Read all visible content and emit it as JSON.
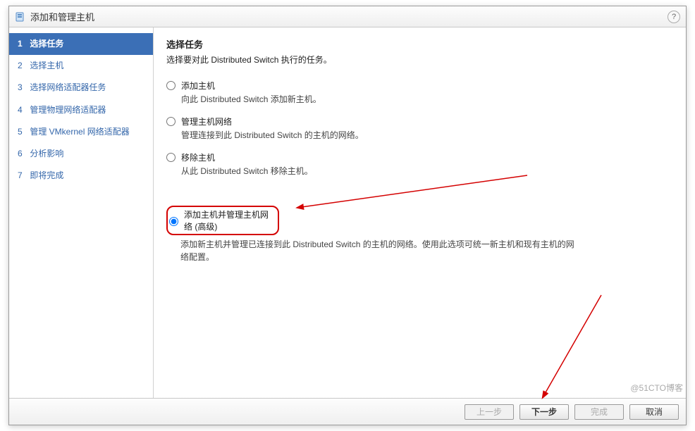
{
  "title": "添加和管理主机",
  "help_tooltip": "?",
  "steps": [
    {
      "num": "1",
      "label": "选择任务",
      "current": true
    },
    {
      "num": "2",
      "label": "选择主机",
      "current": false
    },
    {
      "num": "3",
      "label": "选择网络适配器任务",
      "current": false
    },
    {
      "num": "4",
      "label": "管理物理网络适配器",
      "current": false
    },
    {
      "num": "5",
      "label": "管理 VMkernel 网络适配器",
      "current": false
    },
    {
      "num": "6",
      "label": "分析影响",
      "current": false
    },
    {
      "num": "7",
      "label": "即将完成",
      "current": false
    }
  ],
  "main": {
    "heading": "选择任务",
    "subtitle": "选择要对此 Distributed Switch 执行的任务。",
    "options": [
      {
        "label": "添加主机",
        "desc": "向此 Distributed Switch 添加新主机。",
        "selected": false
      },
      {
        "label": "管理主机网络",
        "desc": "管理连接到此 Distributed Switch 的主机的网络。",
        "selected": false
      },
      {
        "label": "移除主机",
        "desc": "从此 Distributed Switch 移除主机。",
        "selected": false
      },
      {
        "label": "添加主机并管理主机网络 (高级)",
        "desc": "添加新主机并管理已连接到此 Distributed Switch 的主机的网络。使用此选项可统一新主机和现有主机的网络配置。",
        "selected": true,
        "highlighted": true
      }
    ]
  },
  "buttons": {
    "back": "上一步",
    "next": "下一步",
    "finish": "完成",
    "cancel": "取消"
  },
  "watermark": "@51CTO博客"
}
